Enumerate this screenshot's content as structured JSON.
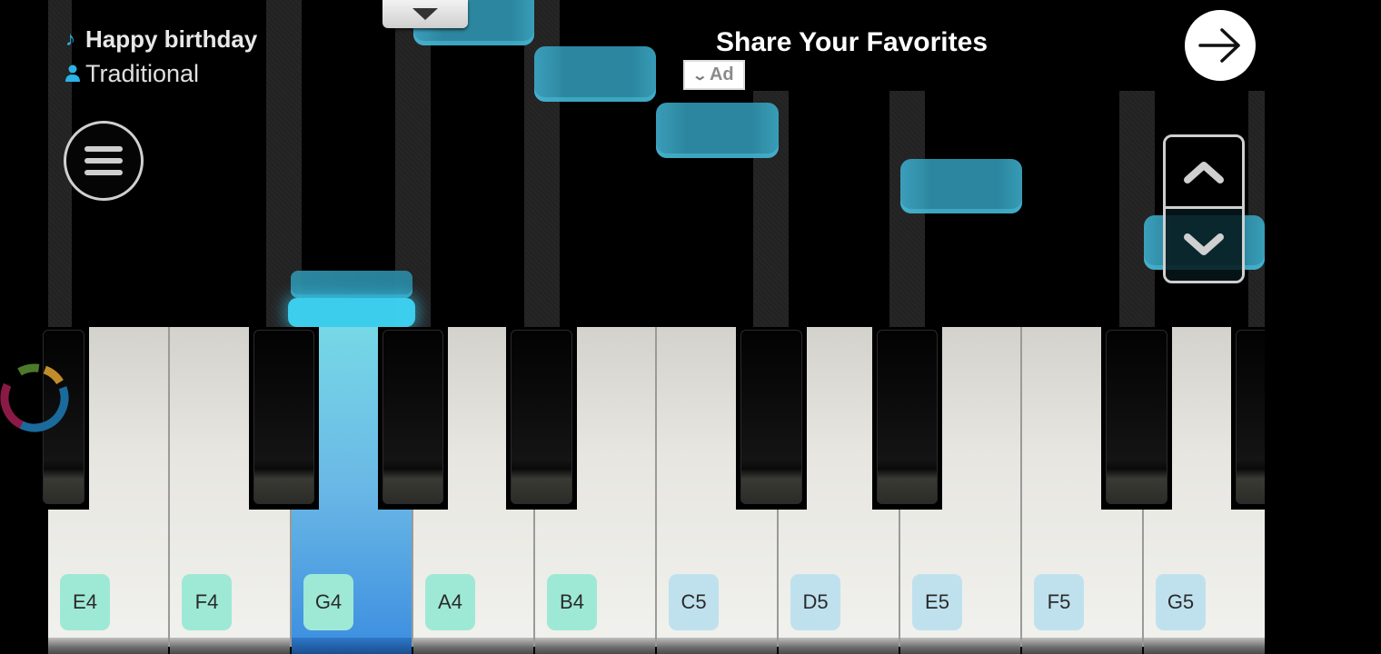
{
  "song": {
    "title": "Happy birthday",
    "author": "Traditional",
    "title_icon": "music-note-icon",
    "author_icon": "person-icon"
  },
  "controls": {
    "menu_icon": "hamburger-menu-icon",
    "dropdown_icon": "triangle-down-icon",
    "scroll_up_icon": "chevron-up-icon",
    "scroll_down_icon": "chevron-down-icon"
  },
  "ad": {
    "title": "Share Your Favorites",
    "badge_label": "Ad",
    "badge_icon": "chevron-down-icon",
    "cta_icon": "arrow-right-icon"
  },
  "keyboard": {
    "white_keys": [
      {
        "note": "E4",
        "label_color": "green",
        "pressed": false
      },
      {
        "note": "F4",
        "label_color": "green",
        "pressed": false
      },
      {
        "note": "G4",
        "label_color": "green",
        "pressed": true
      },
      {
        "note": "A4",
        "label_color": "green",
        "pressed": false
      },
      {
        "note": "B4",
        "label_color": "green",
        "pressed": false
      },
      {
        "note": "C5",
        "label_color": "blue",
        "pressed": false
      },
      {
        "note": "D5",
        "label_color": "blue",
        "pressed": false
      },
      {
        "note": "E5",
        "label_color": "blue",
        "pressed": false
      },
      {
        "note": "F5",
        "label_color": "blue",
        "pressed": false
      },
      {
        "note": "G5",
        "label_color": "blue",
        "pressed": false
      }
    ],
    "black_keys": [
      "D#4",
      "F#4",
      "G#4",
      "A#4",
      "C#5",
      "D#5",
      "F#5",
      "G#5"
    ]
  },
  "falling_notes": [
    "A4",
    "B4",
    "C5",
    "E5",
    "G5",
    "G4"
  ],
  "colors": {
    "note_block": "#2f8ea8",
    "active_note": "#3fd8f8",
    "label_green": "#9ee9d6",
    "label_blue": "#bfe1ee",
    "pressed_key": "#3d8fe0"
  }
}
